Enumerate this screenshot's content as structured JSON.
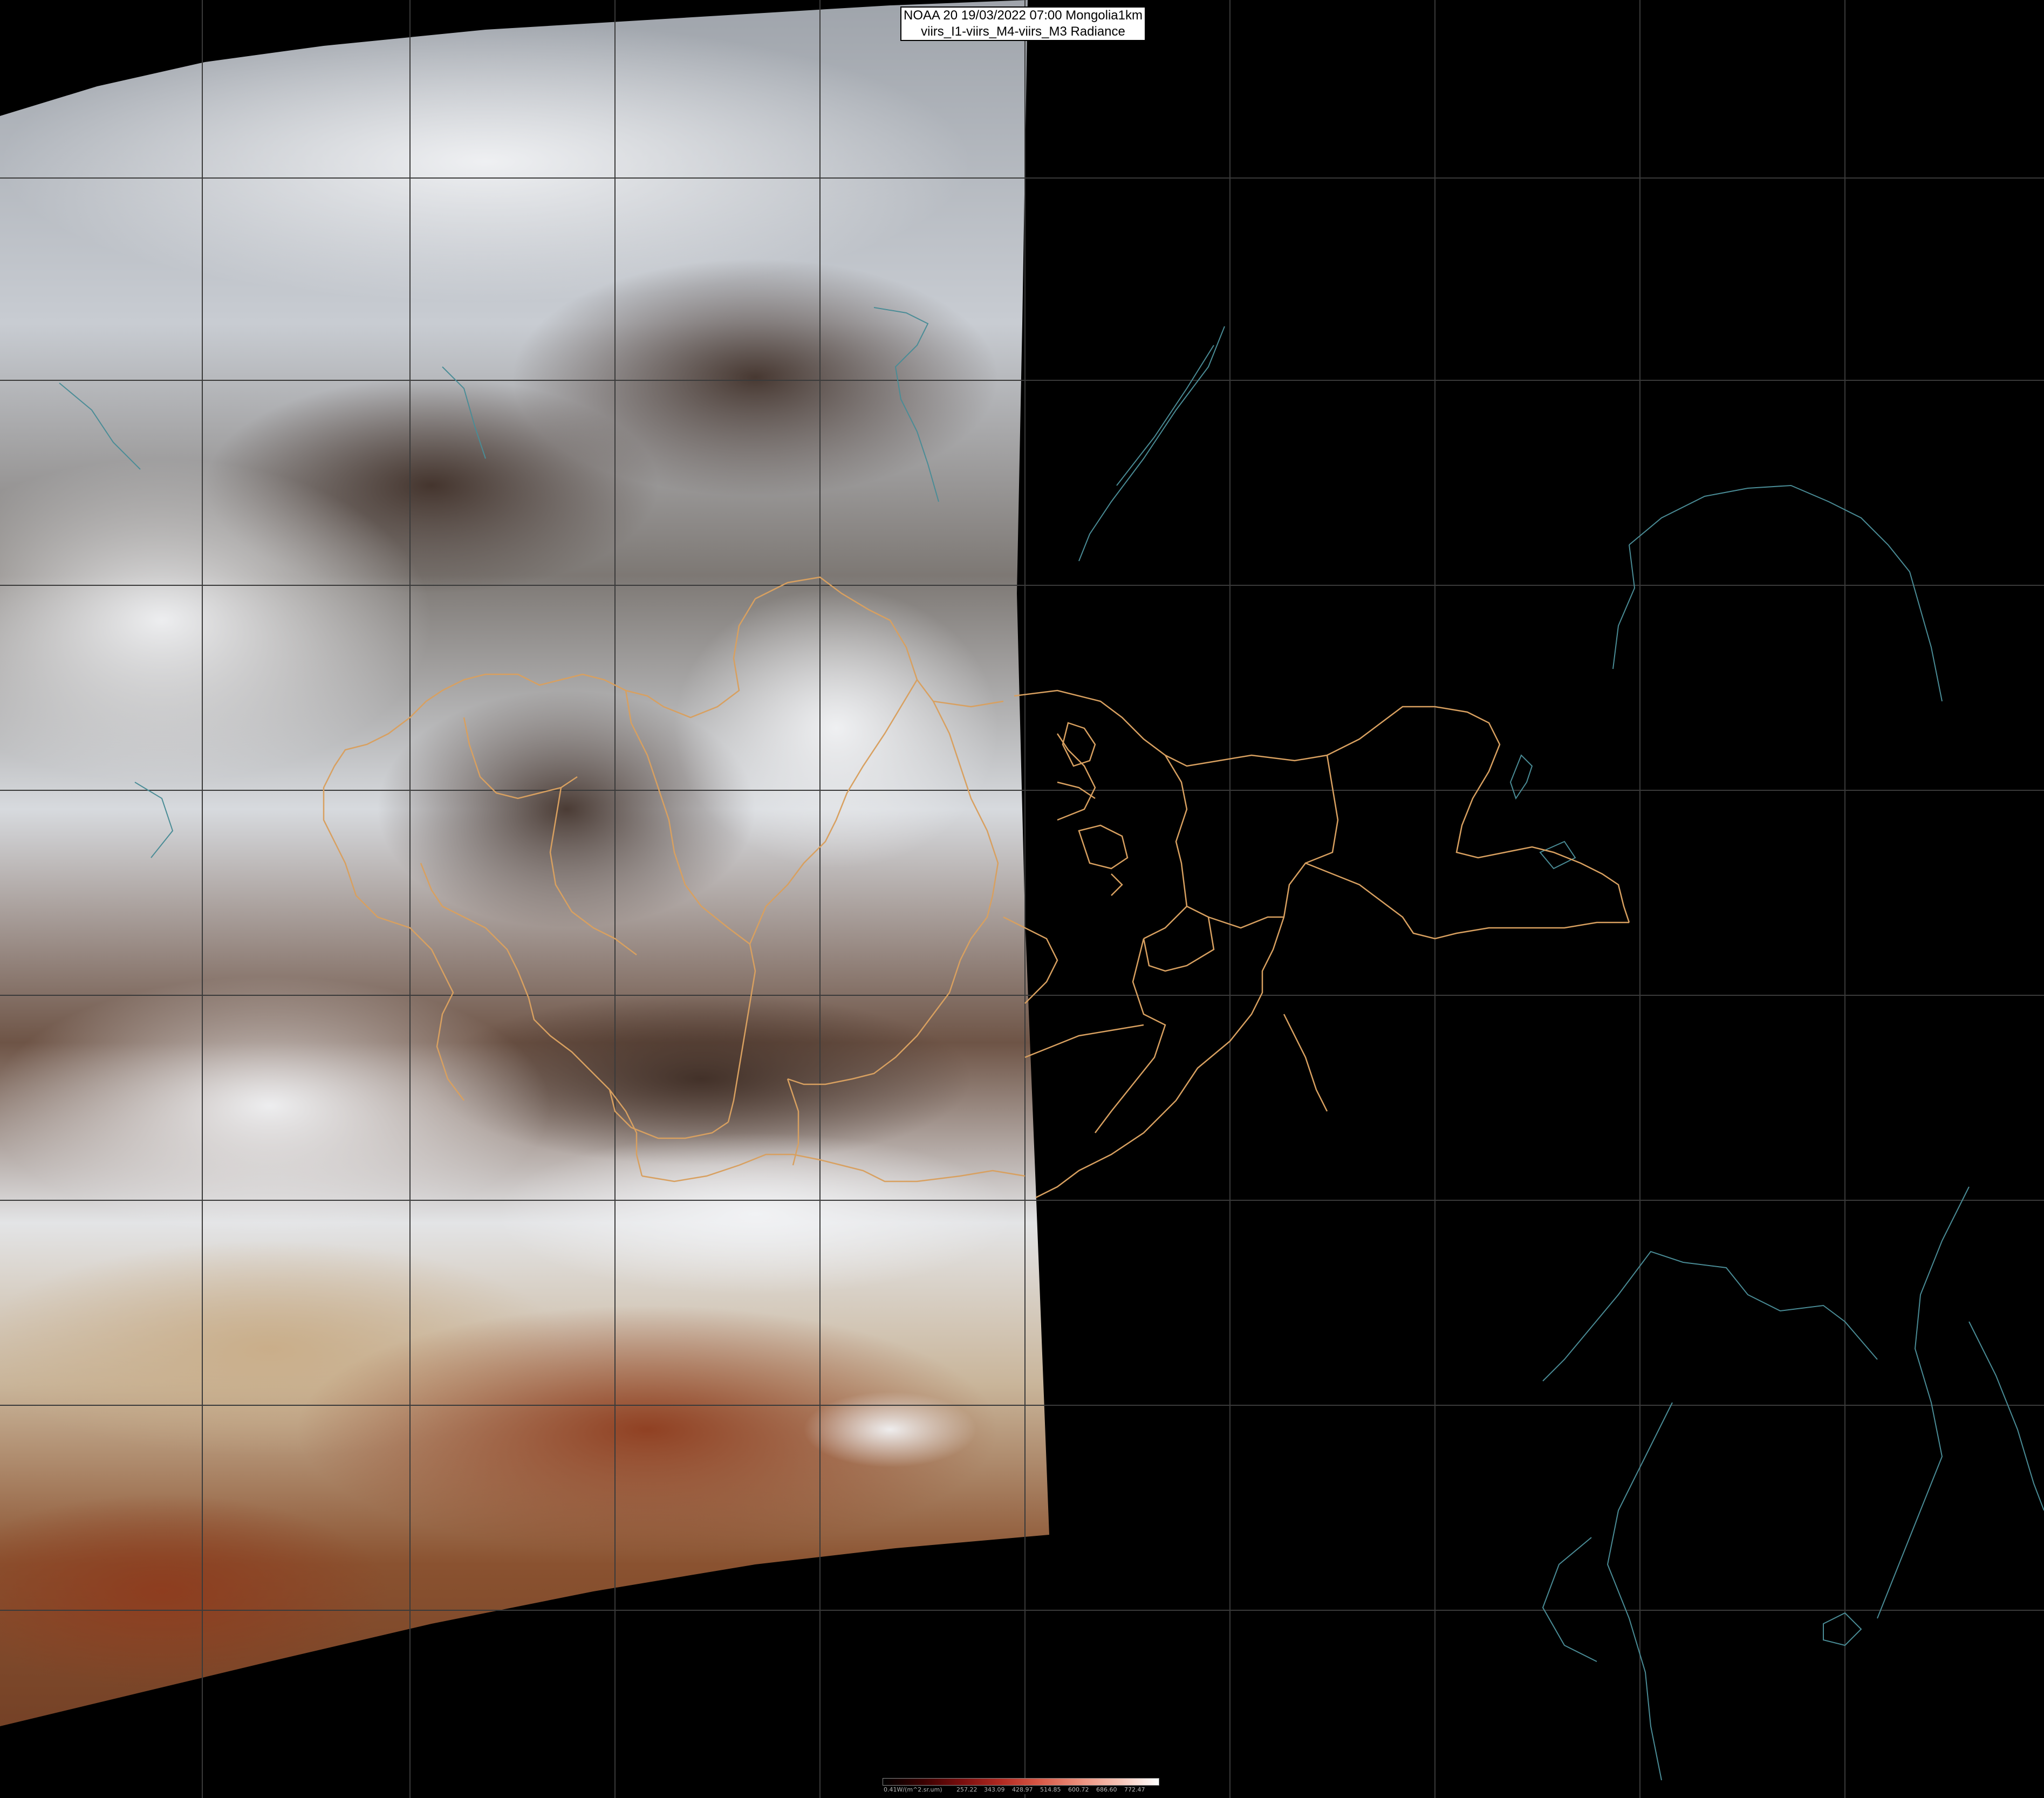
{
  "header": {
    "line1": "NOAA 20 19/03/2022 07:00 Mongolia1km",
    "line2": "viirs_I1-viirs_M4-viirs_M3 Radiance"
  },
  "colorbar": {
    "unit_label": "0.41W/(m^2.sr.um)",
    "ticks": [
      "257.22",
      "343.09",
      "428.97",
      "514.85",
      "600.72",
      "686.60",
      "772.47"
    ],
    "colors": [
      "#000000",
      "#3a0000",
      "#7a0e0e",
      "#b22a22",
      "#d85a48",
      "#ec8f7c",
      "#f6c4b6",
      "#ffffff"
    ]
  },
  "map": {
    "background_color": "#000000",
    "graticule_color": "#3a3a3a",
    "border_color": "#d8a060",
    "coast_color": "#4a8c96"
  }
}
